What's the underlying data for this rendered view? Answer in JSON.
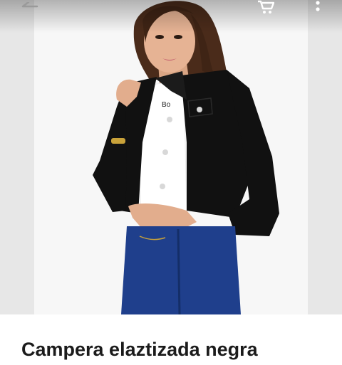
{
  "header": {
    "back_icon": "arrow-back-icon",
    "cart_icon": "shopping-cart-icon",
    "more_icon": "more-vert-icon"
  },
  "product": {
    "title": "Campera elaztizada negra",
    "image": {
      "icon": "product-photo",
      "print_text": "Bo"
    }
  },
  "colors": {
    "backdrop": "#f7f7f7",
    "side_panel": "#e7e7e7",
    "jacket": "#111111",
    "jeans": "#1f3f8c",
    "title": "#1b1b1b"
  }
}
